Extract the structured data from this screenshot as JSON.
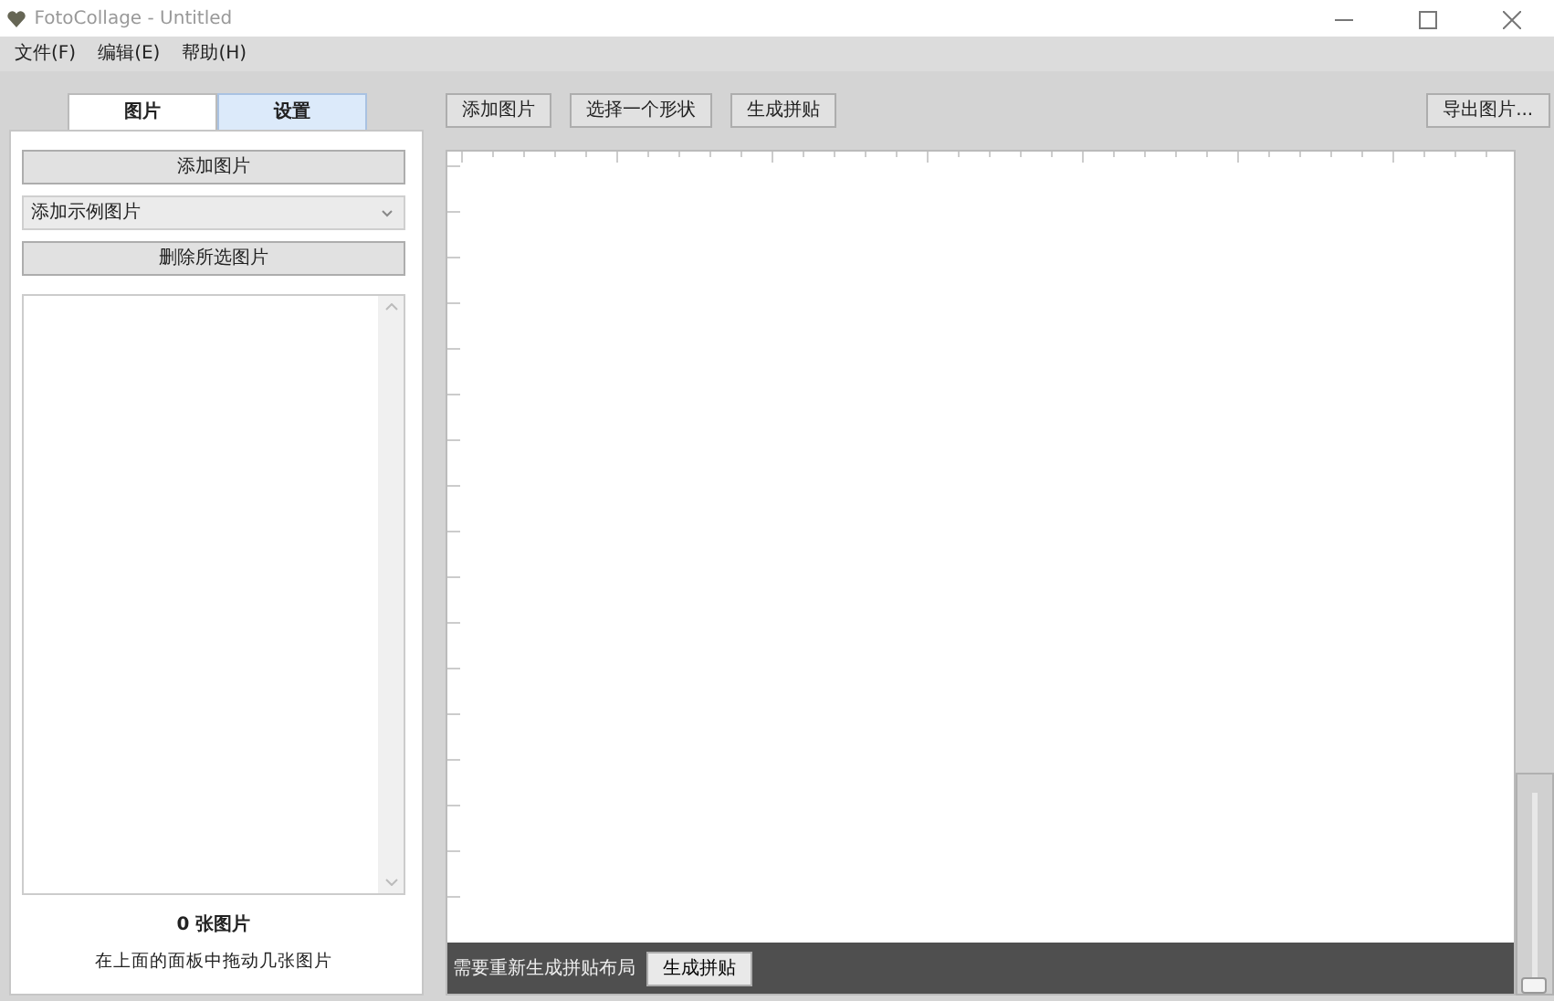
{
  "window": {
    "title": "FotoCollage - Untitled"
  },
  "menu": [
    "文件(F)",
    "编辑(E)",
    "帮助(H)"
  ],
  "tabs": [
    {
      "label": "图片",
      "selected": true
    },
    {
      "label": "设置",
      "selected": false
    }
  ],
  "sidebar": {
    "add_button": "添加图片",
    "sample_dropdown": "添加示例图片",
    "remove_button": "删除所选图片",
    "count": "0 张图片",
    "hint": "在上面的面板中拖动几张图片"
  },
  "toolbar": [
    "添加图片",
    "选择一个形状",
    "生成拼贴"
  ],
  "export_button": "导出图片...",
  "status_bar": {
    "message": "需要重新生成拼贴布局",
    "button": "生成拼贴"
  },
  "zoom_slider": {
    "level": 0
  }
}
